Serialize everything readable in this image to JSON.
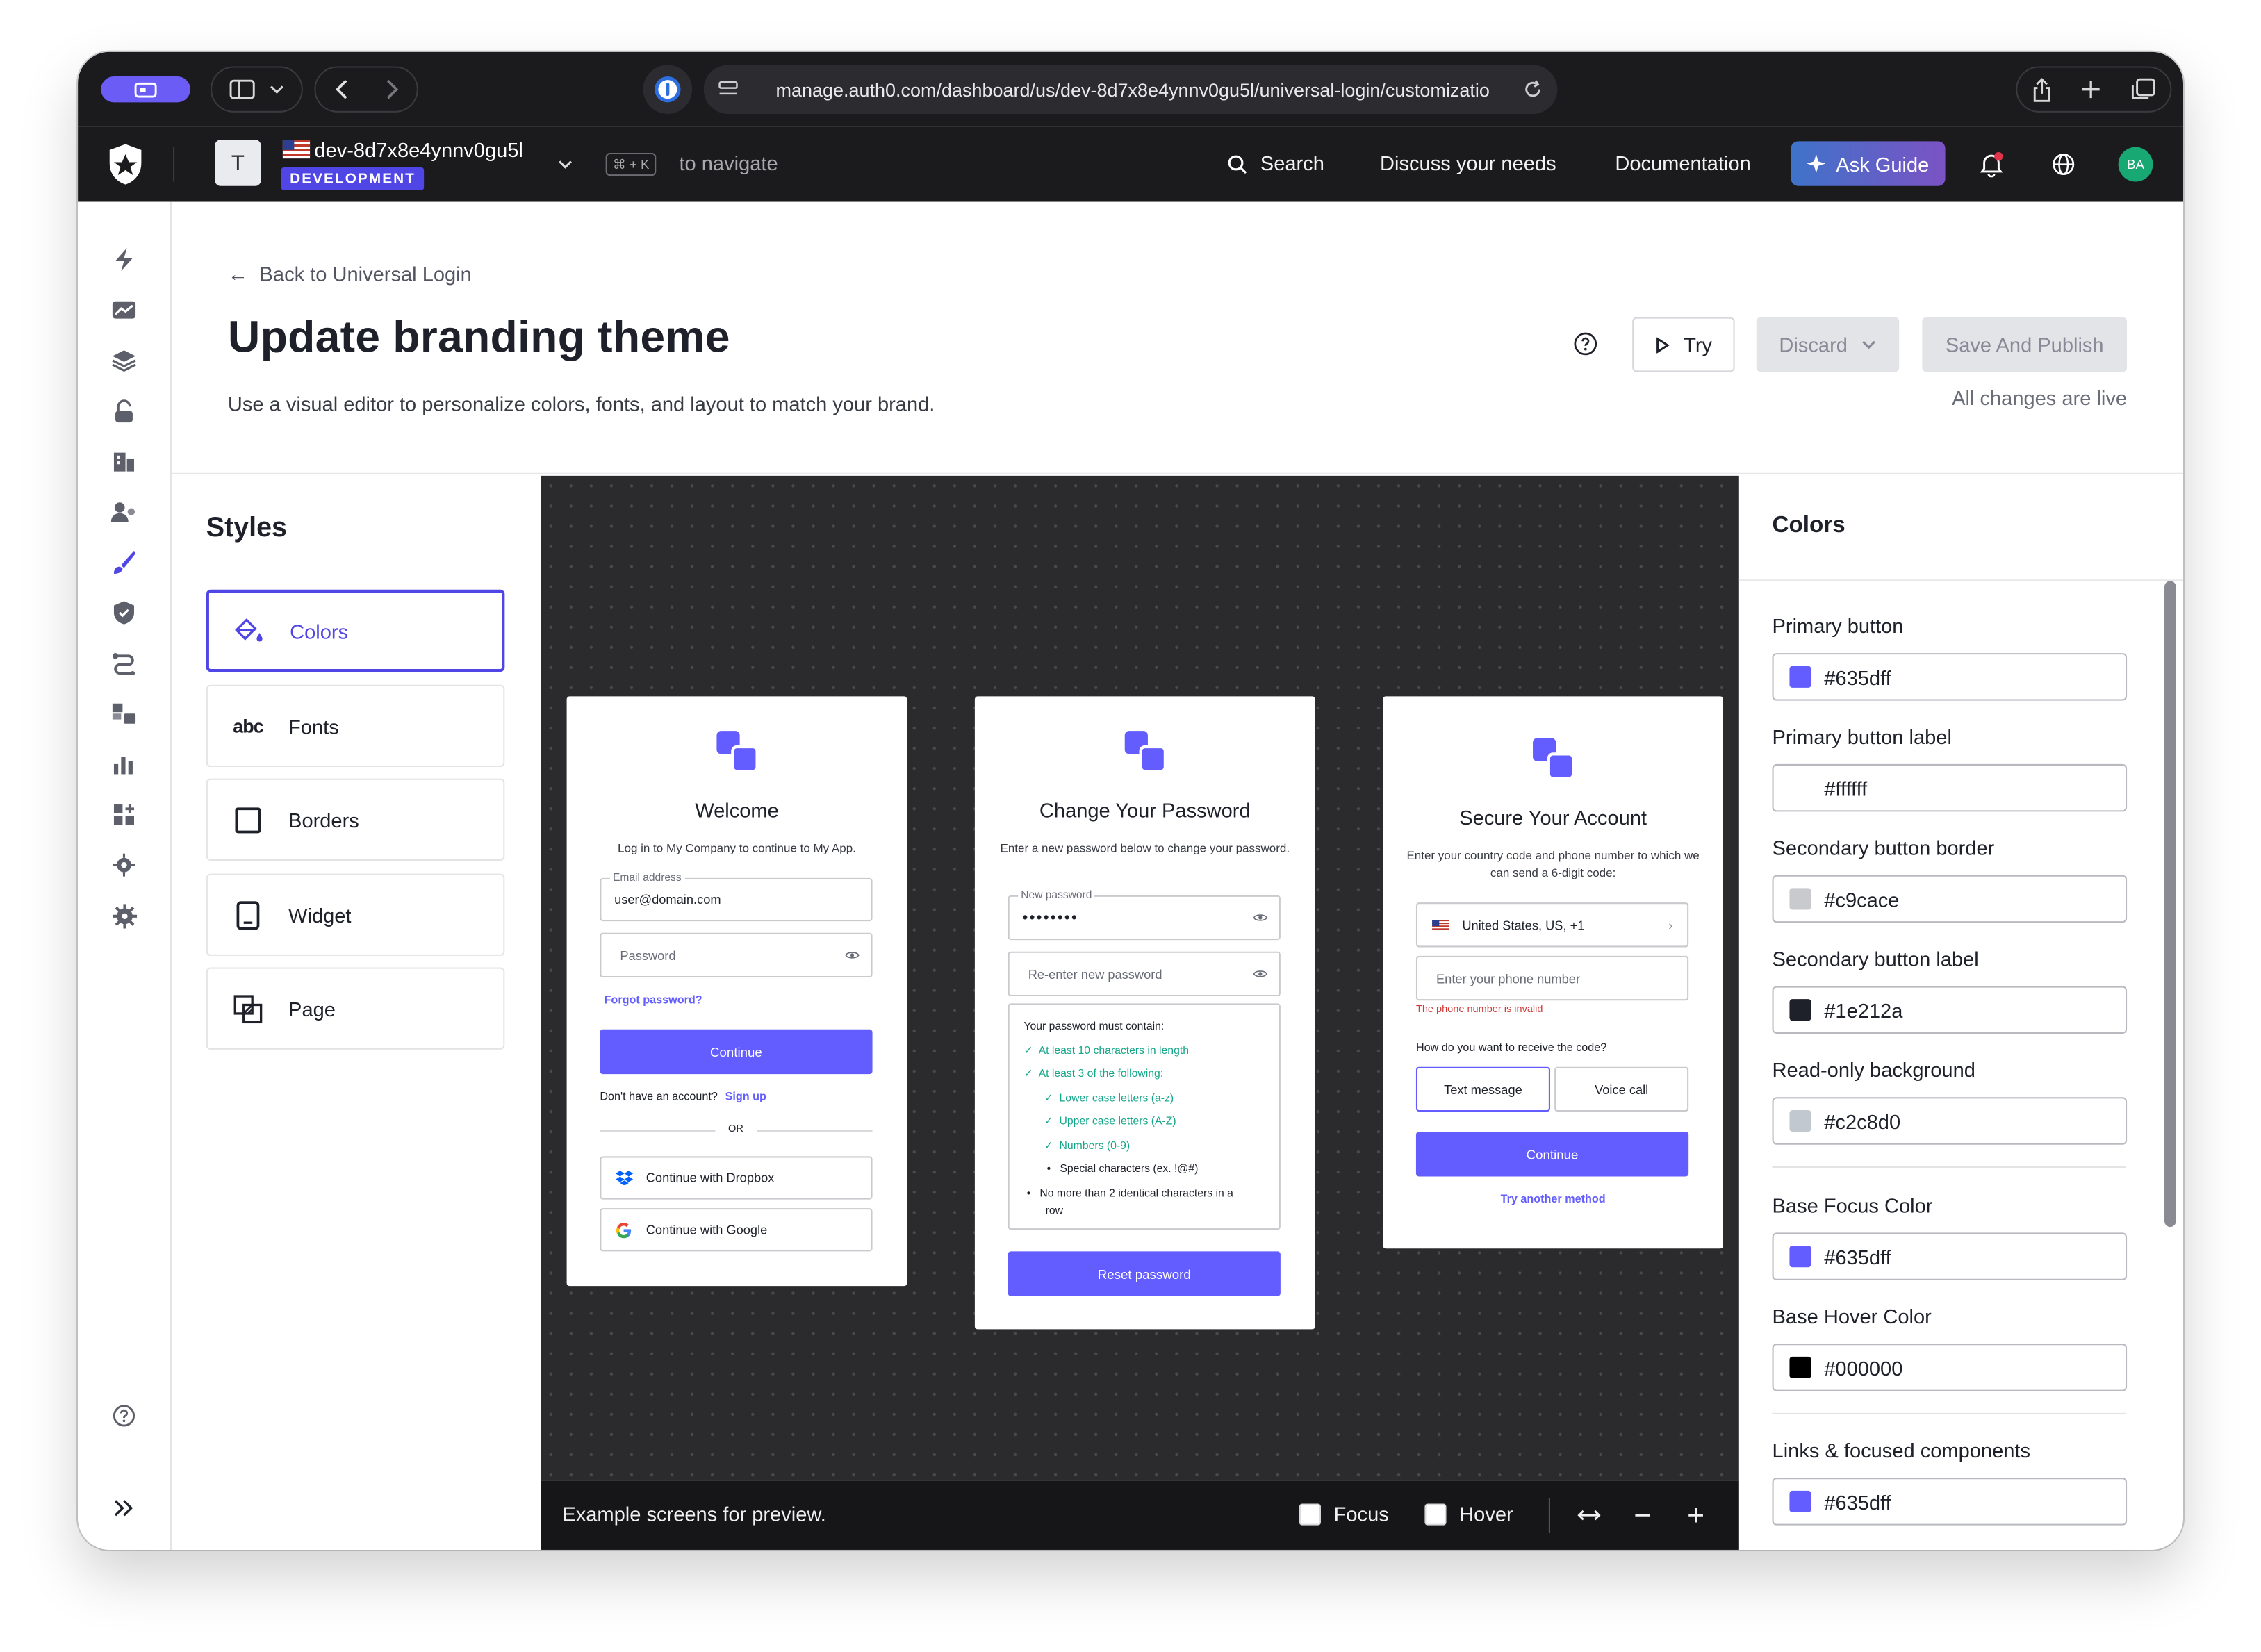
{
  "browser": {
    "url": "manage.auth0.com/dashboard/us/dev-8d7x8e4ynnv0gu5l/universal-login/customizatio"
  },
  "header": {
    "tenant_initial": "T",
    "tenant_name": "dev-8d7x8e4ynnv0gu5l",
    "environment": "DEVELOPMENT",
    "shortcut": "⌘ + K",
    "shortcut_hint": "to navigate",
    "search": "Search",
    "discuss": "Discuss your needs",
    "documentation": "Documentation",
    "ask_guide": "Ask Guide",
    "user_initials": "BA"
  },
  "page": {
    "back_link": "Back to Universal Login",
    "title": "Update branding theme",
    "subtitle": "Use a visual editor to personalize colors, fonts, and layout to match your brand.",
    "try_label": "Try",
    "discard_label": "Discard",
    "save_label": "Save And Publish",
    "live_status": "All changes are live"
  },
  "styles": {
    "title": "Styles",
    "items": [
      {
        "label": "Colors",
        "icon": "paint-bucket-icon",
        "active": true
      },
      {
        "label": "Fonts",
        "icon": "abc-icon"
      },
      {
        "label": "Borders",
        "icon": "square-icon"
      },
      {
        "label": "Widget",
        "icon": "phone-icon"
      },
      {
        "label": "Page",
        "icon": "page-layout-icon"
      }
    ]
  },
  "preview": {
    "footer_text": "Example screens for preview.",
    "focus_label": "Focus",
    "hover_label": "Hover",
    "login": {
      "title": "Welcome",
      "desc": "Log in to My Company to continue to My App.",
      "email_label": "Email address",
      "email_value": "user@domain.com",
      "password_placeholder": "Password",
      "forgot": "Forgot password?",
      "continue": "Continue",
      "no_account": "Don't have an account?",
      "signup": "Sign up",
      "or": "OR",
      "dropbox": "Continue with Dropbox",
      "google": "Continue with Google"
    },
    "change_password": {
      "title": "Change Your Password",
      "desc": "Enter a new password below to change your password.",
      "new_label": "New password",
      "new_value": "••••••••",
      "reenter_placeholder": "Re-enter new password",
      "must_contain": "Your password must contain:",
      "rules": [
        {
          "text": "At least 10 characters in length",
          "ok": true,
          "indent": false
        },
        {
          "text": "At least 3 of the following:",
          "ok": true,
          "indent": false
        },
        {
          "text": "Lower case letters (a-z)",
          "ok": true,
          "indent": true
        },
        {
          "text": "Upper case letters (A-Z)",
          "ok": true,
          "indent": true
        },
        {
          "text": "Numbers (0-9)",
          "ok": true,
          "indent": true
        },
        {
          "text": "Special characters (ex. !@#)",
          "ok": false,
          "indent": true
        },
        {
          "text": "No more than 2 identical characters in a",
          "ok": false,
          "indent": false
        },
        {
          "text": "row",
          "ok": false,
          "indent": false,
          "continuation": true
        }
      ],
      "reset": "Reset password"
    },
    "mfa": {
      "title": "Secure Your Account",
      "desc": "Enter your country code and phone number to which we can send a 6-digit code:",
      "country": "United States, US, +1",
      "phone_placeholder": "Enter your phone number",
      "error": "The phone number is invalid",
      "question": "How do you want to receive the code?",
      "text_message": "Text message",
      "voice_call": "Voice call",
      "continue": "Continue",
      "try_another": "Try another method"
    }
  },
  "colors_panel": {
    "title": "Colors",
    "fields": [
      {
        "label": "Primary button",
        "value": "#635dff",
        "swatch": "#635dff"
      },
      {
        "label": "Primary button label",
        "value": "#ffffff",
        "swatch": "#ffffff"
      },
      {
        "label": "Secondary button border",
        "value": "#c9cace",
        "swatch": "#c9cace"
      },
      {
        "label": "Secondary button label",
        "value": "#1e212a",
        "swatch": "#1e212a"
      },
      {
        "label": "Read-only background",
        "value": "#c2c8d0",
        "swatch": "#c2c8d0"
      },
      {
        "label": "Base Focus Color",
        "value": "#635dff",
        "swatch": "#635dff"
      },
      {
        "label": "Base Hover Color",
        "value": "#000000",
        "swatch": "#000000"
      },
      {
        "label": "Links & focused components",
        "value": "#635dff",
        "swatch": "#635dff"
      }
    ]
  },
  "theme": {
    "accent": "#635dff",
    "brand_indigo": "#4f46e5",
    "success": "#13a688",
    "error": "#d03c38"
  }
}
